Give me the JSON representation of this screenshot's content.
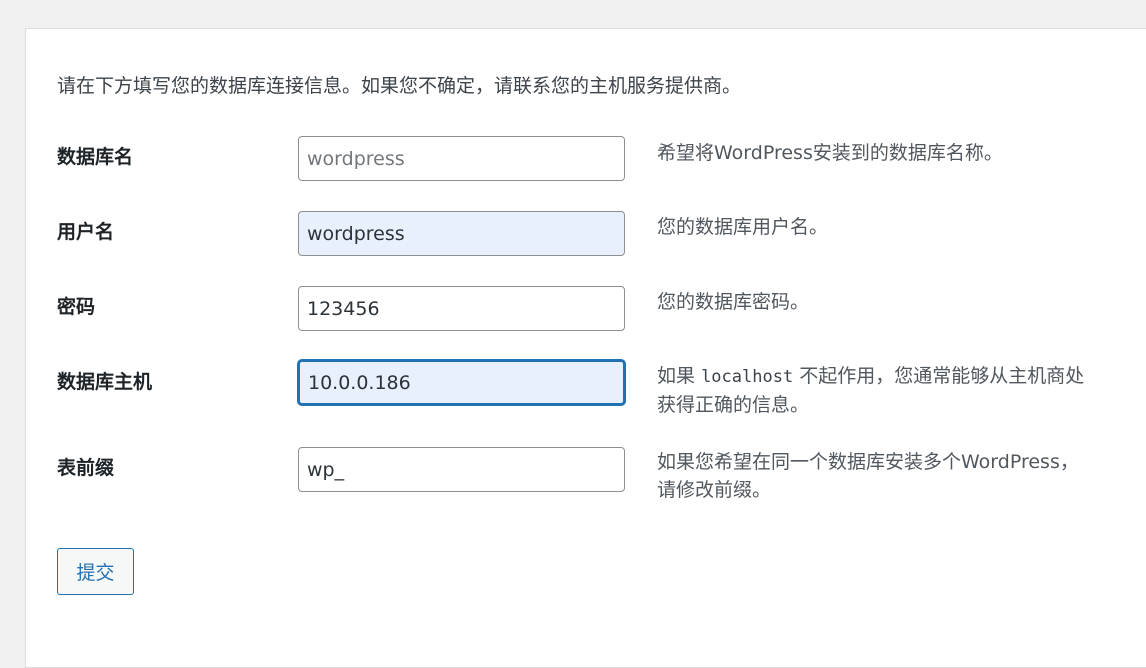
{
  "intro": "请在下方填写您的数据库连接信息。如果您不确定，请联系您的主机服务提供商。",
  "fields": [
    {
      "label": "数据库名",
      "value": "",
      "placeholder": "wordpress",
      "description": "希望将WordPress安装到的数据库名称。"
    },
    {
      "label": "用户名",
      "value": "wordpress",
      "placeholder": "",
      "description": "您的数据库用户名。"
    },
    {
      "label": "密码",
      "value": "123456",
      "placeholder": "",
      "description": "您的数据库密码。"
    },
    {
      "label": "数据库主机",
      "value": "10.0.0.186",
      "placeholder": "",
      "description_before": "如果",
      "description_code": "localhost",
      "description_after": "不起作用，您通常能够从主机商处获得正确的信息。"
    },
    {
      "label": "表前缀",
      "value": "wp_",
      "placeholder": "",
      "description": "如果您希望在同一个数据库安装多个WordPress，请修改前缀。"
    }
  ],
  "submit_label": "提交",
  "colors": {
    "accent": "#2271b1",
    "autofill_bg": "#e8f0fe"
  }
}
